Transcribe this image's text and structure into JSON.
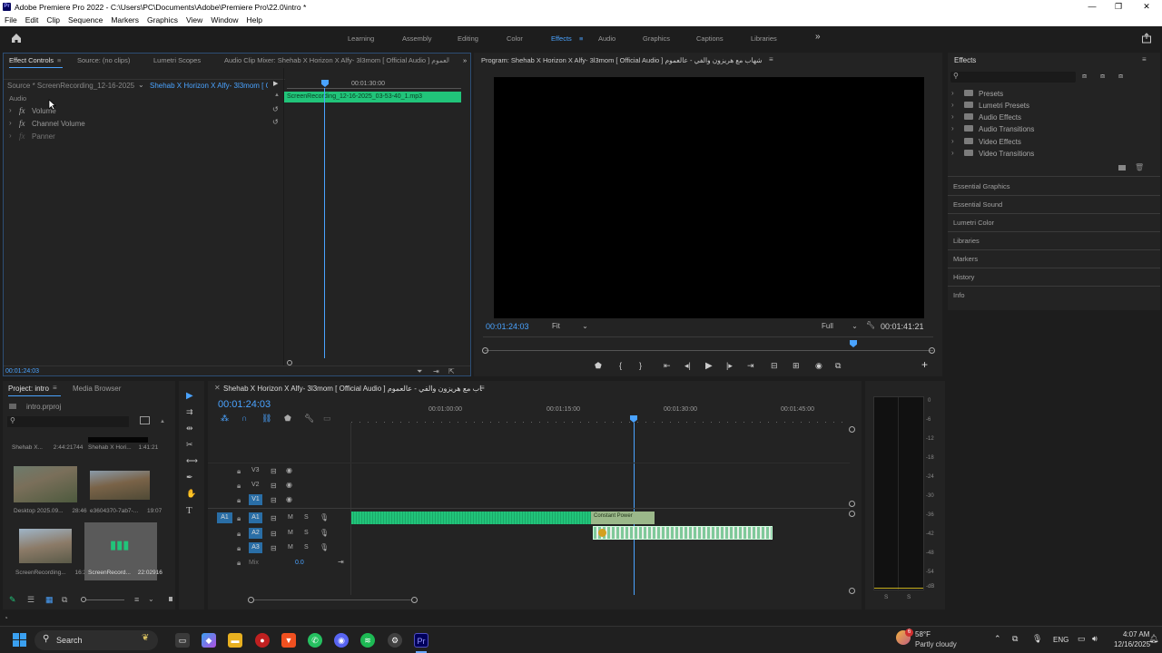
{
  "window": {
    "title": "Adobe Premiere Pro 2022 - C:\\Users\\PC\\Documents\\Adobe\\Premiere Pro\\22.0\\intro *",
    "app_icon": "Pr"
  },
  "window_controls": {
    "minimize": "—",
    "maximize": "❐",
    "close": "✕"
  },
  "menu": [
    "File",
    "Edit",
    "Clip",
    "Sequence",
    "Markers",
    "Graphics",
    "View",
    "Window",
    "Help"
  ],
  "workspaces": [
    "Learning",
    "Assembly",
    "Editing",
    "Color",
    "Effects",
    "Audio",
    "Graphics",
    "Captions",
    "Libraries"
  ],
  "workspace_active": "Effects",
  "workspace_more": "»",
  "effect_controls": {
    "tabs": [
      "Effect Controls",
      "Source: (no clips)",
      "Lumetri Scopes",
      "Audio Clip Mixer: Shehab X Horizon X Alfy- 3l3mom [ Official Audio ] شهاب مع هريزون والفي - عالعموم"
    ],
    "source_label": "Source * ScreenRecording_12-16-2025_...",
    "sequence_label": "Shehab X Horizon X Alfy- 3l3mom [ O...",
    "section_label": "Audio",
    "effects": [
      "Volume",
      "Channel Volume",
      "Panner"
    ],
    "fx_label": "fx",
    "ruler_time": "00:01:30:00",
    "clip_name": "ScreenRecording_12-16-2025_03-53-40_1.mp3",
    "timecode": "00:01:24:03"
  },
  "program": {
    "title": "Program: Shehab X Horizon X Alfy- 3l3mom [ Official Audio ] شهاب مع هريزون والفي - عالعموم",
    "timecode": "00:01:24:03",
    "fit": "Fit",
    "quality": "Full",
    "duration": "00:01:41:21",
    "controls": [
      "marker",
      "in-point",
      "out-point",
      "go-to-in",
      "step-back",
      "play",
      "step-forward",
      "go-to-out",
      "lift",
      "extract",
      "export-frame",
      "compare",
      "add"
    ]
  },
  "effects_panel": {
    "title": "Effects",
    "folders": [
      "Presets",
      "Lumetri Presets",
      "Audio Effects",
      "Audio Transitions",
      "Video Effects",
      "Video Transitions"
    ],
    "collapsed_panels": [
      "Essential Graphics",
      "Essential Sound",
      "Lumetri Color",
      "Libraries",
      "Markers",
      "History",
      "Info"
    ]
  },
  "project": {
    "tabs": [
      "Project: intro",
      "Media Browser"
    ],
    "file": "intro.prproj",
    "items": [
      {
        "name": "Shehab X...",
        "duration": "2:44:21744"
      },
      {
        "name": "Shehab X Hori...",
        "duration": "1:41:21"
      },
      {
        "name": "Desktop 2025.09...",
        "duration": "28:46"
      },
      {
        "name": "e3604370-7ab7-...",
        "duration": "19:07"
      },
      {
        "name": "ScreenRecording...",
        "duration": "16:25"
      },
      {
        "name": "ScreenRecord...",
        "duration": "22:02916"
      }
    ]
  },
  "timeline": {
    "title": "Shehab X Horizon X Alfy- 3l3mom [ Official Audio ] شهاب مع هريزون والفي - عالعموم",
    "timecode": "00:01:24:03",
    "ruler": [
      "00:01:00:00",
      "00:01:15:00",
      "00:01:30:00",
      "00:01:45:00"
    ],
    "video_tracks": [
      "V3",
      "V2",
      "V1"
    ],
    "audio_tracks": [
      "A1",
      "A2",
      "A3"
    ],
    "source_patch": "A1",
    "mix_label": "Mix",
    "mix_value": "0.0",
    "clip_label": "Constant Power",
    "track_m": "M",
    "track_s": "S"
  },
  "meter": {
    "ticks": [
      "0",
      "-6",
      "-12",
      "-18",
      "-24",
      "-30",
      "-36",
      "-42",
      "-48",
      "-54",
      "-dB"
    ],
    "solo": [
      "S",
      "S"
    ]
  },
  "taskbar": {
    "search": "Search",
    "weather_temp": "58°F",
    "weather_desc": "Partly cloudy",
    "lang": "ENG",
    "time": "4:07 AM",
    "date": "12/16/2025",
    "notification_count": "6"
  },
  "colors": {
    "accent": "#4aa3ff",
    "audio_clip": "#21c47a",
    "track_patch": "#2a6ea6"
  }
}
